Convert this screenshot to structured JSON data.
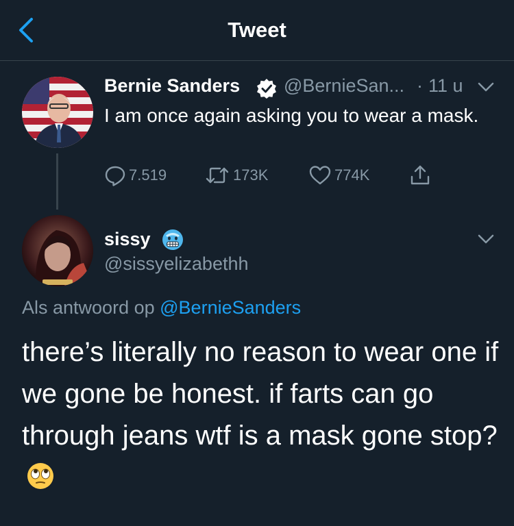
{
  "header": {
    "title": "Tweet"
  },
  "colors": {
    "background": "#15202b",
    "secondary_text": "#8899a6",
    "link": "#1da1f2",
    "divider": "#38444d",
    "verified": "#ffffff"
  },
  "original_tweet": {
    "name": "Bernie Sanders",
    "handle": "@BernieSan...",
    "separator": "·",
    "time": "11 u",
    "text": "I am once again asking you to wear a mask.",
    "replies": "7.519",
    "retweets": "173K",
    "likes": "774K"
  },
  "reply_tweet": {
    "name": "sissy",
    "name_emoji_icon": "cold-face-emoji",
    "handle": "@sissyelizabethh",
    "replying_prefix": "Als antwoord op",
    "replying_to": "@BernieSanders",
    "text": "there’s literally no reason to wear one if we gone be honest. if farts can go through jeans wtf is a mask gone stop?",
    "trailing_emoji_icon": "face-with-rolling-eyes-emoji"
  }
}
